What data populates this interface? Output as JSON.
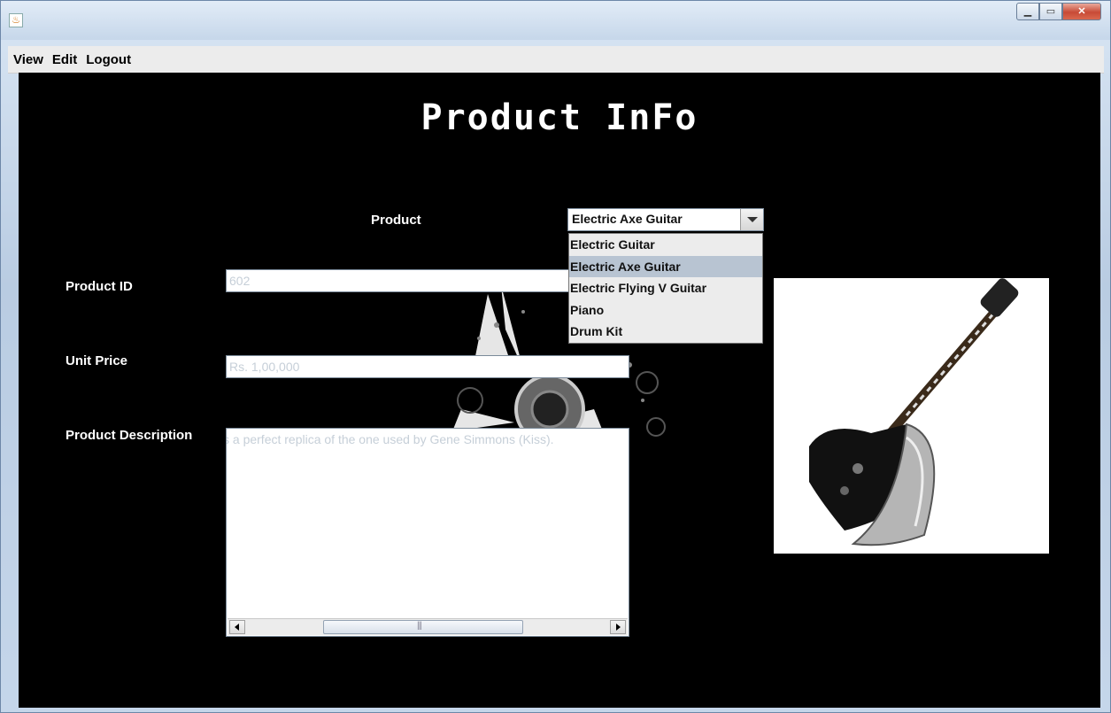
{
  "window": {
    "title": ""
  },
  "menu": {
    "items": [
      "View",
      "Edit",
      "Logout"
    ]
  },
  "page": {
    "title": "Product InFo"
  },
  "form": {
    "product_label": "Product",
    "product_selected": "Electric Axe Guitar",
    "product_options": [
      "Electric Guitar",
      "Electric Axe Guitar",
      "Electric Flying V Guitar",
      "Piano",
      "Drum Kit"
    ],
    "product_id_label": "Product ID",
    "product_id_value": "602",
    "unit_price_label": "Unit Price",
    "unit_price_value": "Rs. 1,00,000",
    "description_label": "Product Description",
    "description_value": "s a perfect replica of the one used by Gene Simmons (Kiss)."
  },
  "colors": {
    "background": "#000000",
    "label": "#ffffff",
    "selected_option": "#b8c4d2",
    "field_text": "#c6cfd8"
  },
  "icons": [
    "java-app-icon",
    "minimize-icon",
    "maximize-icon",
    "close-icon",
    "chevron-down-icon",
    "scroll-left-icon",
    "scroll-right-icon"
  ]
}
